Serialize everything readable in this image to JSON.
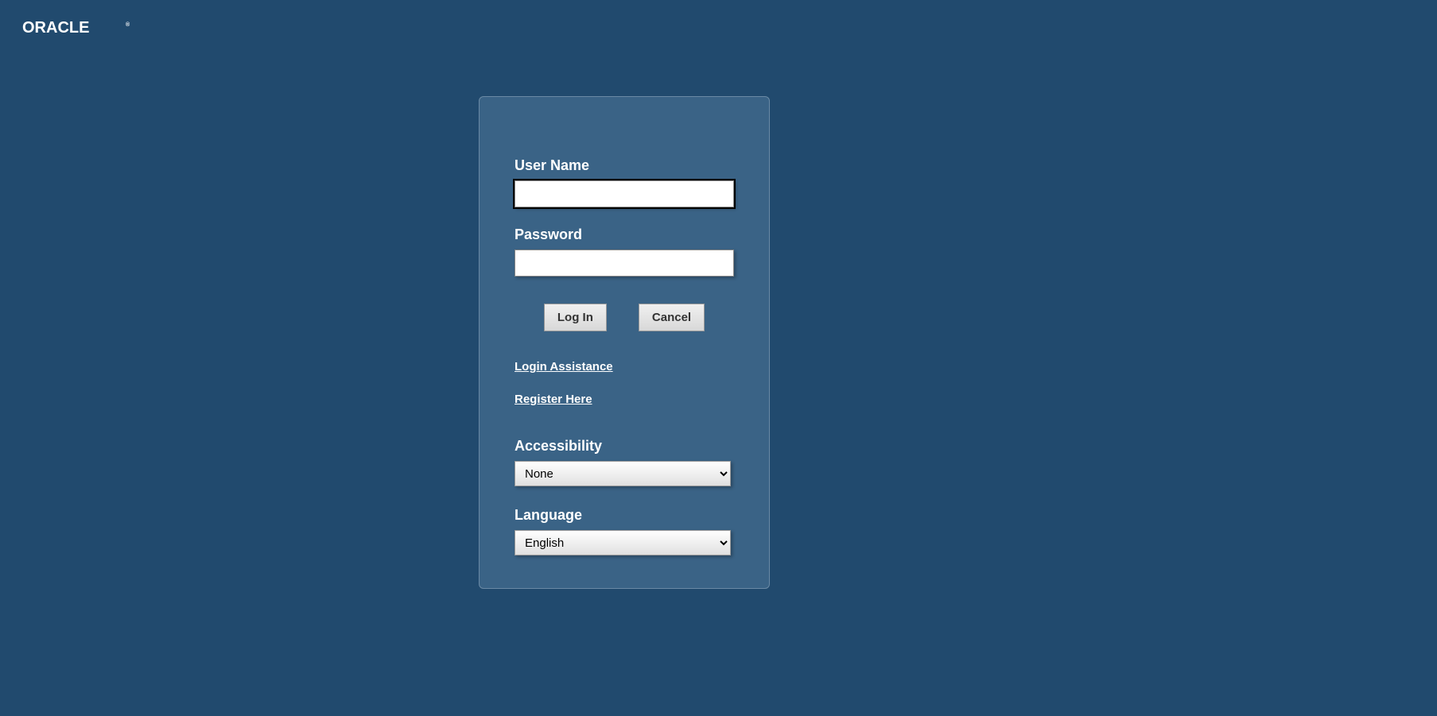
{
  "logo": "ORACLE",
  "form": {
    "username_label": "User Name",
    "username_value": "",
    "password_label": "Password",
    "password_value": "",
    "login_button": "Log In",
    "cancel_button": "Cancel"
  },
  "links": {
    "login_assistance": "Login Assistance",
    "register": "Register Here"
  },
  "accessibility": {
    "label": "Accessibility",
    "selected": "None"
  },
  "language": {
    "label": "Language",
    "selected": "English"
  }
}
